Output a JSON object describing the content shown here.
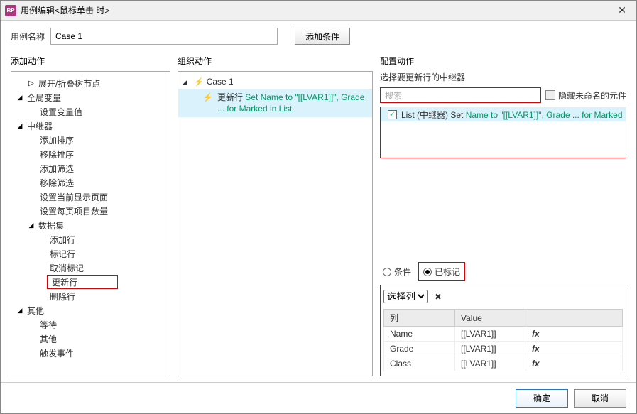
{
  "window": {
    "title": "用例编辑<鼠标单击 时>",
    "appIcon": "RP"
  },
  "caseName": {
    "label": "用例名称",
    "value": "Case 1"
  },
  "addCondition": "添加条件",
  "columns": {
    "addAction": "添加动作",
    "orgAction": "组织动作",
    "cfgAction": "配置动作"
  },
  "tree": {
    "expandCollapse": "展开/折叠树节点",
    "globalVar": "全局变量",
    "setVar": "设置变量值",
    "repeater": "中继器",
    "addSort": "添加排序",
    "removeSort": "移除排序",
    "addFilter": "添加筛选",
    "removeFilter": "移除筛选",
    "setCurrentPage": "设置当前显示页面",
    "setItemsPerPage": "设置每页项目数量",
    "dataset": "数据集",
    "addRow": "添加行",
    "markRow": "标记行",
    "unmarkRow": "取消标记",
    "updateRow": "更新行",
    "deleteRow": "删除行",
    "other": "其他",
    "wait": "等待",
    "other2": "其他",
    "triggerEvent": "触发事件"
  },
  "org": {
    "caseLabel": "Case 1",
    "actionPrefix": "更新行 ",
    "actionGreen": "Set Name to \"[[LVAR1]]\", Grade ... for Marked in List"
  },
  "cfg": {
    "selectRepeater": "选择要更新行的中继器",
    "searchPlaceholder": "搜索",
    "hideUnnamed": "隐藏未命名的元件",
    "listItemPrefix": "List (中继器) Set ",
    "listItemGreen": "Name to \"[[LVAR1]]\", Grade ... for Marked",
    "radioCondition": "条件",
    "radioMarked": "已标记",
    "selectColumn": "选择列",
    "tableHeaders": {
      "col": "列",
      "val": "Value",
      "fx": ""
    },
    "tableRows": [
      {
        "col": "Name",
        "val": "[[LVAR1]]",
        "fx": "fx"
      },
      {
        "col": "Grade",
        "val": "[[LVAR1]]",
        "fx": "fx"
      },
      {
        "col": "Class",
        "val": "[[LVAR1]]",
        "fx": "fx"
      }
    ]
  },
  "footer": {
    "ok": "确定",
    "cancel": "取消"
  }
}
